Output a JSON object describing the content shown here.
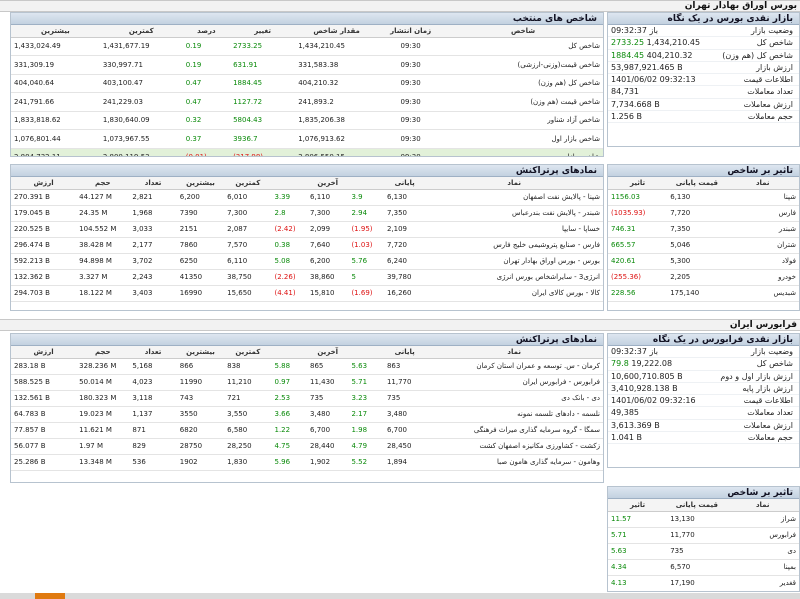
{
  "title1": "بورس اوراق بهادار تهران",
  "bourse_cash": {
    "title": "بازار نقدی بورس در یک نگاه",
    "rows": [
      {
        "k": "وضعیت بازار",
        "v": "باز 09:32:37"
      },
      {
        "k": "شاخص کل",
        "a": "2733.25",
        "b": "1,434,210.45"
      },
      {
        "k": "شاخص کل (هم وزن)",
        "a": "1884.45",
        "b": "404,210.32"
      },
      {
        "k": "ارزش بازار",
        "v": "53,987,921.465 B"
      },
      {
        "k": "اطلاعات قیمت",
        "v": "1401/06/02 09:32:13"
      },
      {
        "k": "تعداد معاملات",
        "v": "84,731"
      },
      {
        "k": "ارزش معاملات",
        "v": "7,734.668 B"
      },
      {
        "k": "حجم معاملات",
        "v": "1.256 B"
      }
    ]
  },
  "indices": {
    "title": "شاخص های منتخب",
    "headers": [
      "شاخص",
      "زمان انتشار",
      "مقدار شاخص",
      "تغییر",
      "درصد",
      "کمترین",
      "بیشترین"
    ],
    "rows": [
      {
        "name": "شاخص کل",
        "time": "09:30",
        "value": "1,434,210.45",
        "change": "2733.25",
        "pct": "0.19",
        "min": "1,431,677.19",
        "max": "1,433,024.49",
        "neg": false
      },
      {
        "name": "شاخص قیمت(وزنی-ارزشی)",
        "time": "09:30",
        "value": "331,583.38",
        "change": "631.91",
        "pct": "0.19",
        "min": "330,997.71",
        "max": "331,309.19",
        "neg": false
      },
      {
        "name": "شاخص کل (هم وزن)",
        "time": "09:30",
        "value": "404,210.32",
        "change": "1884.45",
        "pct": "0.47",
        "min": "403,100.47",
        "max": "404,040.64",
        "neg": false
      },
      {
        "name": "شاخص قیمت (هم وزن)",
        "time": "09:30",
        "value": "241,893.2",
        "change": "1127.72",
        "pct": "0.47",
        "min": "241,229.03",
        "max": "241,791.66",
        "neg": false
      },
      {
        "name": "شاخص آزاد شناور",
        "time": "09:30",
        "value": "1,835,206.38",
        "change": "5804.43",
        "pct": "0.32",
        "min": "1,830,640.09",
        "max": "1,833,818.62",
        "neg": false
      },
      {
        "name": "شاخص بازار اول",
        "time": "09:30",
        "value": "1,076,913.62",
        "change": "3936.7",
        "pct": "0.37",
        "min": "1,073,967.55",
        "max": "1,076,801.44",
        "neg": false
      },
      {
        "name": "شاخص بازار دوم",
        "time": "09:30",
        "value": "2,806,550.15",
        "change": "(317.98)",
        "pct": "(0.01)",
        "min": "2,800,119.53",
        "max": "2,804,732.11",
        "neg": true
      }
    ]
  },
  "bourse_impact": {
    "title": "تاثیر بر شاخص",
    "headers": [
      "نماد",
      "قیمت پایانی",
      "تاثیر"
    ],
    "rows": [
      {
        "sym": "شپنا",
        "price": "6,130",
        "impact": "1156.03",
        "neg": false
      },
      {
        "sym": "فارس",
        "price": "7,720",
        "impact": "(1035.93)",
        "neg": true
      },
      {
        "sym": "شبندر",
        "price": "7,350",
        "impact": "746.31",
        "neg": false
      },
      {
        "sym": "شتران",
        "price": "5,046",
        "impact": "665.57",
        "neg": false
      },
      {
        "sym": "فولاد",
        "price": "5,300",
        "impact": "420.61",
        "neg": false
      },
      {
        "sym": "خودرو",
        "price": "2,205",
        "impact": "(255.36)",
        "neg": true
      },
      {
        "sym": "شبدیس",
        "price": "175,140",
        "impact": "228.56",
        "neg": false
      }
    ]
  },
  "bourse_top": {
    "title": "نمادهای پرتراکنش",
    "headers": [
      "نماد",
      "پایانی",
      "",
      "آخرین",
      "",
      "کمترین",
      "بیشترین",
      "تعداد",
      "حجم",
      "ارزش"
    ],
    "rows": [
      {
        "sym": "شپنا - پالایش نفت اصفهان",
        "close": "6,130",
        "cp": "3.9",
        "last": "6,110",
        "lp": "3.39",
        "min": "6,010",
        "max": "6,200",
        "count": "2,821",
        "vol": "44.127 M",
        "val": "270.391 B",
        "cn": false,
        "ln": false
      },
      {
        "sym": "شبندر - پالایش نفت بندرعباس",
        "close": "7,350",
        "cp": "2.94",
        "last": "7,300",
        "lp": "2.8",
        "min": "7,300",
        "max": "7390",
        "count": "1,968",
        "vol": "24.35 M",
        "val": "179.045 B",
        "cn": false,
        "ln": false
      },
      {
        "sym": "خساپا - سایپا",
        "close": "2,109",
        "cp": "(1.95)",
        "last": "2,099",
        "lp": "(2.42)",
        "min": "2,087",
        "max": "2151",
        "count": "3,033",
        "vol": "104.552 M",
        "val": "220.525 B",
        "cn": true,
        "ln": true
      },
      {
        "sym": "فارس - صنایع پتروشیمی خلیج فارس",
        "close": "7,720",
        "cp": "(1.03)",
        "last": "7,640",
        "lp": "0.38",
        "min": "7,570",
        "max": "7860",
        "count": "2,177",
        "vol": "38.428 M",
        "val": "296.474 B",
        "cn": true,
        "ln": false
      },
      {
        "sym": "بورس - بورس اوراق بهادار تهران",
        "close": "6,240",
        "cp": "5.76",
        "last": "6,200",
        "lp": "5.08",
        "min": "6,110",
        "max": "6250",
        "count": "3,702",
        "vol": "94.898 M",
        "val": "592.213 B",
        "cn": false,
        "ln": false
      },
      {
        "sym": "انرژی3 - سایراشخاص بورس انرژی",
        "close": "39,780",
        "cp": "5",
        "last": "38,860",
        "lp": "(2.26)",
        "min": "38,750",
        "max": "41350",
        "count": "2,243",
        "vol": "3.327 M",
        "val": "132.362 B",
        "cn": false,
        "ln": true
      },
      {
        "sym": "کالا - بورس کالای ایران",
        "close": "16,260",
        "cp": "(1.69)",
        "last": "15,810",
        "lp": "(4.41)",
        "min": "15,650",
        "max": "16990",
        "count": "3,403",
        "vol": "18.122 M",
        "val": "294.703 B",
        "cn": true,
        "ln": true
      }
    ]
  },
  "title2": "فرابورس ایران",
  "fara_cash": {
    "title": "بازار نقدی فرابورس در یک نگاه",
    "rows": [
      {
        "k": "وضعیت بازار",
        "v": "باز 09:32:37"
      },
      {
        "k": "شاخص کل",
        "a": "79.8",
        "b": "19,222.08"
      },
      {
        "k": "ارزش بازار اول و دوم",
        "v": "10,600,710.805 B"
      },
      {
        "k": "ارزش بازار پایه",
        "v": "3,410,928.138 B"
      },
      {
        "k": "اطلاعات قیمت",
        "v": "1401/06/02 09:32:16"
      },
      {
        "k": "تعداد معاملات",
        "v": "49,385"
      },
      {
        "k": "ارزش معاملات",
        "v": "3,613.369 B"
      },
      {
        "k": "حجم معاملات",
        "v": "1.041 B"
      }
    ]
  },
  "fara_top": {
    "title": "نمادهای پرتراکنش",
    "headers": [
      "نماد",
      "پایانی",
      "",
      "آخرین",
      "",
      "کمترین",
      "بیشترین",
      "تعداد",
      "حجم",
      "ارزش"
    ],
    "rows": [
      {
        "sym": "کرمان - س. توسعه و عمران استان کرمان",
        "close": "863",
        "cp": "5.63",
        "last": "865",
        "lp": "5.88",
        "min": "838",
        "max": "866",
        "count": "5,168",
        "vol": "328.236 M",
        "val": "283.18 B",
        "cn": false,
        "ln": false
      },
      {
        "sym": "فرابورس - فرابورس ایران",
        "close": "11,770",
        "cp": "5.71",
        "last": "11,430",
        "lp": "0.97",
        "min": "11,210",
        "max": "11990",
        "count": "4,023",
        "vol": "50.014 M",
        "val": "588.525 B",
        "cn": false,
        "ln": false
      },
      {
        "sym": "دی - بانک دی",
        "close": "735",
        "cp": "3.23",
        "last": "735",
        "lp": "2.53",
        "min": "721",
        "max": "743",
        "count": "3,118",
        "vol": "180.323 M",
        "val": "132.561 B",
        "cn": false,
        "ln": false
      },
      {
        "sym": "نلسمه - دادهای تلسمه نمونه",
        "close": "3,480",
        "cp": "2.17",
        "last": "3,480",
        "lp": "3.66",
        "min": "3,550",
        "max": "3550",
        "count": "1,137",
        "vol": "19.023 M",
        "val": "64.783 B",
        "cn": false,
        "ln": false
      },
      {
        "sym": "سمگا - گروه سرمایه گذاری میراث فرهنگی",
        "close": "6,700",
        "cp": "1.98",
        "last": "6,700",
        "lp": "1.22",
        "min": "6,580",
        "max": "6820",
        "count": "871",
        "vol": "11.621 M",
        "val": "77.857 B",
        "cn": false,
        "ln": false
      },
      {
        "sym": "زکشت - کشاورزی مکانیزه اصفهان کشت",
        "close": "28,450",
        "cp": "4.79",
        "last": "28,440",
        "lp": "4.75",
        "min": "28,250",
        "max": "28750",
        "count": "829",
        "vol": "1.97 M",
        "val": "56.077 B",
        "cn": false,
        "ln": false
      },
      {
        "sym": "وهامون - سرمایه گذاری هامون صبا",
        "close": "1,894",
        "cp": "5.52",
        "last": "1,902",
        "lp": "5.96",
        "min": "1,830",
        "max": "1902",
        "count": "536",
        "vol": "13.348 M",
        "val": "25.286 B",
        "cn": false,
        "ln": false
      }
    ]
  },
  "fara_impact": {
    "title": "تاثیر بر شاخص",
    "headers": [
      "نماد",
      "قیمت پایانی",
      "تاثیر"
    ],
    "rows": [
      {
        "sym": "شراز",
        "price": "13,130",
        "impact": "11.57",
        "neg": false
      },
      {
        "sym": "فرابورس",
        "price": "11,770",
        "impact": "5.71",
        "neg": false
      },
      {
        "sym": "دی",
        "price": "735",
        "impact": "5.63",
        "neg": false
      },
      {
        "sym": "بمپنا",
        "price": "6,570",
        "impact": "4.34",
        "neg": false
      },
      {
        "sym": "قغدیر",
        "price": "17,190",
        "impact": "4.13",
        "neg": false
      }
    ]
  }
}
